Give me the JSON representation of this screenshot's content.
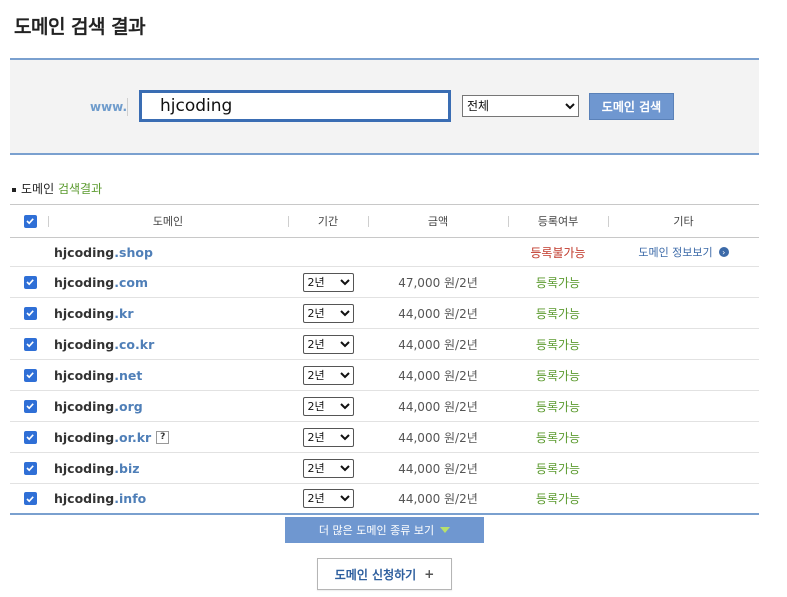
{
  "page": {
    "title": "도메인 검색 결과"
  },
  "search": {
    "prefix": "www.",
    "domain_value": "hjcoding",
    "tld_selected": "전체",
    "button_label": "도메인 검색"
  },
  "results": {
    "title_prefix": "도메인",
    "title_highlight": "검색결과",
    "columns": [
      "도메인",
      "기간",
      "금액",
      "등록여부",
      "기타"
    ],
    "unavailable": {
      "name": "hjcoding",
      "tld": ".shop",
      "status": "등록불가능",
      "etc": "도메인 정보보기",
      "etc_icon": "arrow-circle-icon"
    },
    "rows": [
      {
        "name": "hjcoding",
        "tld": ".com",
        "period": "2년",
        "price": "47,000 원/2년",
        "status": "등록가능",
        "checked": true
      },
      {
        "name": "hjcoding",
        "tld": ".kr",
        "period": "2년",
        "price": "44,000 원/2년",
        "status": "등록가능",
        "checked": true
      },
      {
        "name": "hjcoding",
        "tld": ".co.kr",
        "period": "2년",
        "price": "44,000 원/2년",
        "status": "등록가능",
        "checked": true
      },
      {
        "name": "hjcoding",
        "tld": ".net",
        "period": "2년",
        "price": "44,000 원/2년",
        "status": "등록가능",
        "checked": true
      },
      {
        "name": "hjcoding",
        "tld": ".org",
        "period": "2년",
        "price": "44,000 원/2년",
        "status": "등록가능",
        "checked": true
      },
      {
        "name": "hjcoding",
        "tld": ".or.kr",
        "period": "2년",
        "price": "44,000 원/2년",
        "status": "등록가능",
        "checked": true,
        "help": "?"
      },
      {
        "name": "hjcoding",
        "tld": ".biz",
        "period": "2년",
        "price": "44,000 원/2년",
        "status": "등록가능",
        "checked": true
      },
      {
        "name": "hjcoding",
        "tld": ".info",
        "period": "2년",
        "price": "44,000 원/2년",
        "status": "등록가능",
        "checked": true
      }
    ]
  },
  "more_button": {
    "label": "더 많은 도메인 종류 보기",
    "icon": "triangle-down-icon"
  },
  "apply_button": {
    "label": "도메인 신청하기",
    "icon_text": "+"
  },
  "colors": {
    "accent": "#6f97d0",
    "available": "#5b9a2e",
    "unavailable": "#c0392b",
    "tld": "#4f7fb8"
  }
}
